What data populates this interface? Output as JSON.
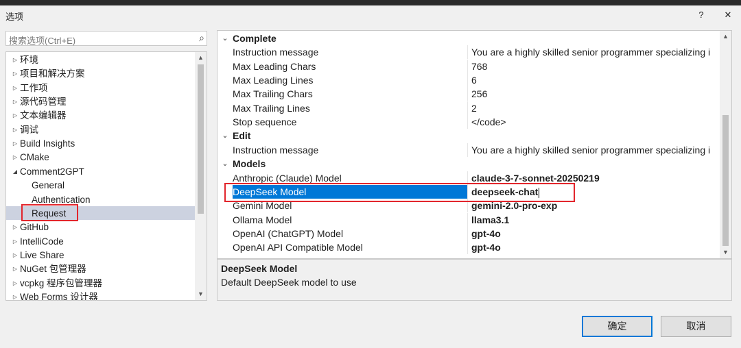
{
  "window": {
    "title": "选项",
    "help_label": "?",
    "close_label": "✕"
  },
  "search": {
    "placeholder": "搜索选项(Ctrl+E)",
    "icon": "search-icon"
  },
  "tree": {
    "items": [
      {
        "label": "环境",
        "expanded": false
      },
      {
        "label": "项目和解决方案",
        "expanded": false
      },
      {
        "label": "工作项",
        "expanded": false
      },
      {
        "label": "源代码管理",
        "expanded": false
      },
      {
        "label": "文本编辑器",
        "expanded": false
      },
      {
        "label": "调试",
        "expanded": false
      },
      {
        "label": "Build Insights",
        "expanded": false
      },
      {
        "label": "CMake",
        "expanded": false
      },
      {
        "label": "Comment2GPT",
        "expanded": true
      },
      {
        "label": "General",
        "child": true
      },
      {
        "label": "Authentication",
        "child": true
      },
      {
        "label": "Request",
        "child": true,
        "selected": true
      },
      {
        "label": "GitHub",
        "expanded": false
      },
      {
        "label": "IntelliCode",
        "expanded": false
      },
      {
        "label": "Live Share",
        "expanded": false
      },
      {
        "label": "NuGet 包管理器",
        "expanded": false
      },
      {
        "label": "vcpkg 程序包管理器",
        "expanded": false
      },
      {
        "label": "Web Forms 设计器",
        "expanded": false
      }
    ]
  },
  "grid": {
    "rows": [
      {
        "type": "category",
        "label": "Complete"
      },
      {
        "type": "prop",
        "name": "Instruction message",
        "value": "You are a highly skilled senior programmer specializing i"
      },
      {
        "type": "prop",
        "name": "Max Leading Chars",
        "value": "768"
      },
      {
        "type": "prop",
        "name": "Max Leading Lines",
        "value": "6"
      },
      {
        "type": "prop",
        "name": "Max Trailing Chars",
        "value": "256"
      },
      {
        "type": "prop",
        "name": "Max Trailing Lines",
        "value": "2"
      },
      {
        "type": "prop",
        "name": "Stop sequence",
        "value": "</code>"
      },
      {
        "type": "category",
        "label": "Edit"
      },
      {
        "type": "prop",
        "name": "Instruction message",
        "value": "You are a highly skilled senior programmer specializing i"
      },
      {
        "type": "category",
        "label": "Models"
      },
      {
        "type": "prop",
        "name": "Anthropic (Claude) Model",
        "value": "claude-3-7-sonnet-20250219",
        "bold": true
      },
      {
        "type": "prop",
        "name": "DeepSeek Model",
        "value": "deepseek-chat",
        "bold": true,
        "selected": true
      },
      {
        "type": "prop",
        "name": "Gemini Model",
        "value": "gemini-2.0-pro-exp",
        "bold": true
      },
      {
        "type": "prop",
        "name": "Ollama Model",
        "value": "llama3.1",
        "bold": true
      },
      {
        "type": "prop",
        "name": "OpenAI (ChatGPT) Model",
        "value": "gpt-4o",
        "bold": true
      },
      {
        "type": "prop",
        "name": "OpenAI API Compatible Model",
        "value": "gpt-4o",
        "bold": true
      }
    ]
  },
  "description": {
    "title": "DeepSeek Model",
    "text": "Default DeepSeek model to use"
  },
  "buttons": {
    "ok": "确定",
    "cancel": "取消"
  },
  "colors": {
    "selection": "#0078d7",
    "highlight_box": "#e2252c",
    "tree_selected": "#ccd2e0"
  }
}
